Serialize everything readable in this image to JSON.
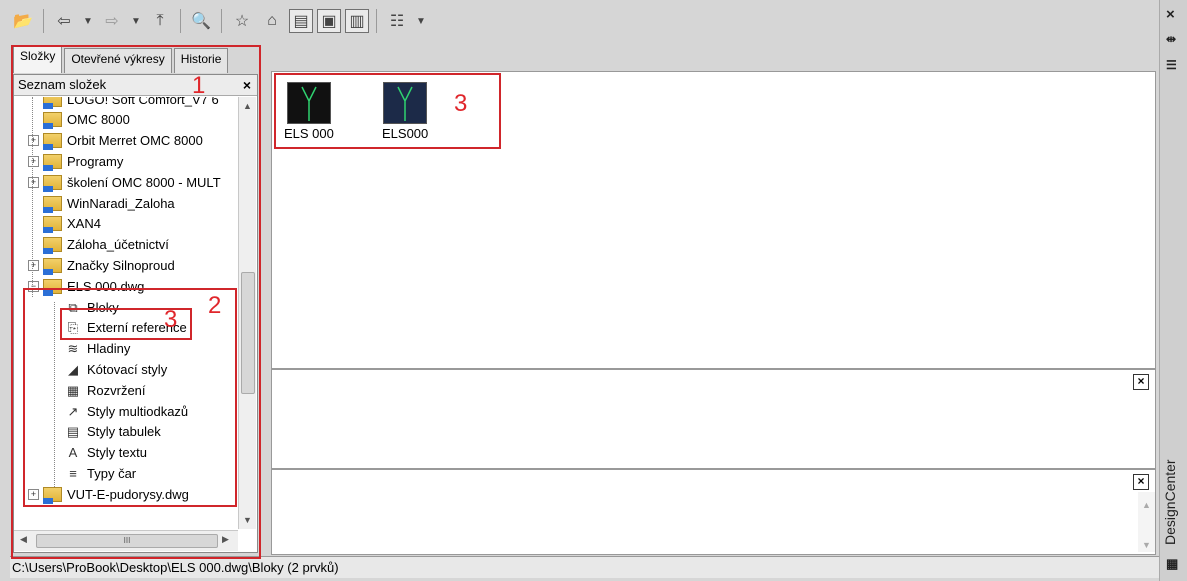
{
  "toolbar": {
    "icons": [
      "load-icon",
      "back-icon",
      "dropdown-icon",
      "forward-icon",
      "dropdown-icon",
      "up-icon",
      "search-icon",
      "favorites-icon",
      "home-icon",
      "tree-toggle-icon",
      "preview-icon",
      "description-icon",
      "views-icon",
      "dropdown-icon"
    ]
  },
  "tabs": [
    {
      "label": "Složky"
    },
    {
      "label": "Otevřené výkresy"
    },
    {
      "label": "Historie"
    }
  ],
  "left_panel": {
    "header": "Seznam složek",
    "close": "×",
    "tree": [
      {
        "label": "LOGO! Soft Comfort_V7 6",
        "expander": ""
      },
      {
        "label": "OMC 8000",
        "expander": ""
      },
      {
        "label": "Orbit Merret OMC 8000",
        "expander": "+"
      },
      {
        "label": "Programy",
        "expander": "+"
      },
      {
        "label": "školení OMC 8000 - MULT",
        "expander": "+"
      },
      {
        "label": "WinNaradi_Zaloha",
        "expander": ""
      },
      {
        "label": "XAN4",
        "expander": ""
      },
      {
        "label": "Záloha_účetnictví",
        "expander": ""
      },
      {
        "label": "Značky Silnoproud",
        "expander": "+"
      },
      {
        "label": "ELS 000.dwg",
        "expander": "−"
      },
      {
        "label": "Bloky",
        "expander": ""
      },
      {
        "label": "Externí reference",
        "expander": ""
      },
      {
        "label": "Hladiny",
        "expander": ""
      },
      {
        "label": "Kótovací styly",
        "expander": ""
      },
      {
        "label": "Rozvržení",
        "expander": ""
      },
      {
        "label": "Styly multiodkazů",
        "expander": ""
      },
      {
        "label": "Styly tabulek",
        "expander": ""
      },
      {
        "label": "Styly textu",
        "expander": ""
      },
      {
        "label": "Typy čar",
        "expander": ""
      },
      {
        "label": "VUT-E-pudorysy.dwg",
        "expander": "+"
      }
    ]
  },
  "content_items": [
    {
      "label": "ELS 000"
    },
    {
      "label": "ELS000"
    }
  ],
  "status": "C:\\Users\\ProBook\\Desktop\\ELS 000.dwg\\Bloky (2 prvků)",
  "sidebar": {
    "title": "DesignCenter",
    "close": "×"
  },
  "annotations": {
    "n1": "1",
    "n2": "2",
    "n3a": "3",
    "n3b": "3"
  },
  "colors": {
    "annotation": "#d0262b"
  }
}
